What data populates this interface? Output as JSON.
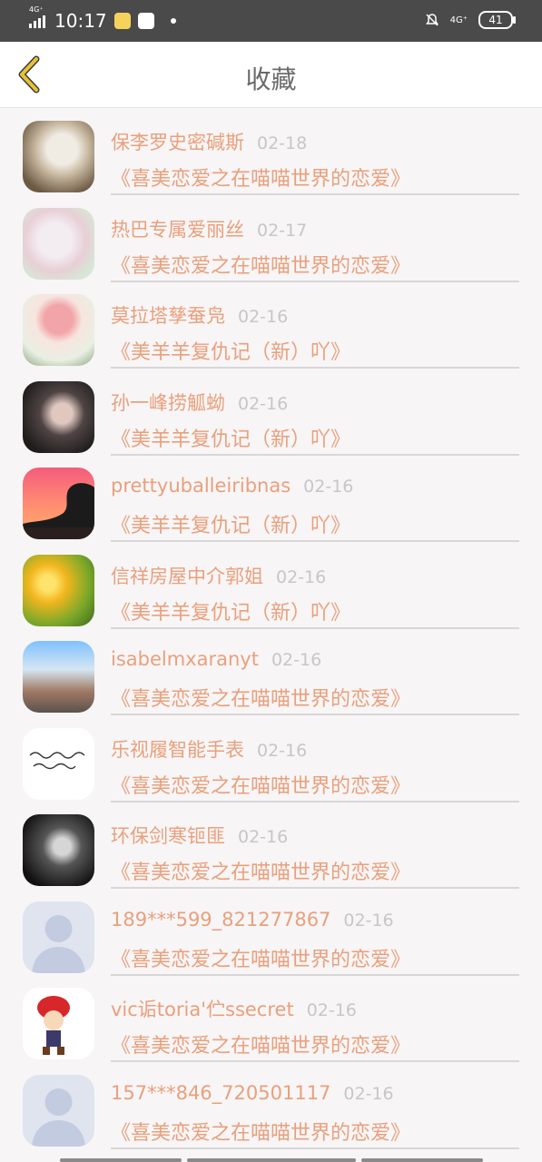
{
  "status_bar": {
    "left_network": "4G⁺",
    "time": "10:17",
    "right_network": "4G⁺",
    "battery": "41"
  },
  "header": {
    "title": "收藏"
  },
  "favorites": [
    {
      "name": "保李罗史密碱斯",
      "date": "02-18",
      "work": "《喜美恋爱之在喵喵世界的恋爱》"
    },
    {
      "name": "热巴专属爱丽丝",
      "date": "02-17",
      "work": "《喜美恋爱之在喵喵世界的恋爱》"
    },
    {
      "name": "莫拉塔孳蚕凫",
      "date": "02-16",
      "work": "《美羊羊复仇记（新）吖》"
    },
    {
      "name": "孙一峰捞觚蚴",
      "date": "02-16",
      "work": "《美羊羊复仇记（新）吖》"
    },
    {
      "name": "prettyuballeiribnas",
      "date": "02-16",
      "work": "《美羊羊复仇记（新）吖》"
    },
    {
      "name": "信祥房屋中介郭姐",
      "date": "02-16",
      "work": "《美羊羊复仇记（新）吖》"
    },
    {
      "name": "isabelmxaranyt",
      "date": "02-16",
      "work": "《喜美恋爱之在喵喵世界的恋爱》"
    },
    {
      "name": "乐视履智能手表",
      "date": "02-16",
      "work": "《喜美恋爱之在喵喵世界的恋爱》"
    },
    {
      "name": "环保剑寒钷匪",
      "date": "02-16",
      "work": "《喜美恋爱之在喵喵世界的恋爱》"
    },
    {
      "name": "189***599_821277867",
      "date": "02-16",
      "work": "《喜美恋爱之在喵喵世界的恋爱》"
    },
    {
      "name": "vic诟toria'伫ssecret",
      "date": "02-16",
      "work": "《喜美恋爱之在喵喵世界的恋爱》"
    },
    {
      "name": "157***846_720501117",
      "date": "02-16",
      "work": "《喜美恋爱之在喵喵世界的恋爱》"
    }
  ]
}
